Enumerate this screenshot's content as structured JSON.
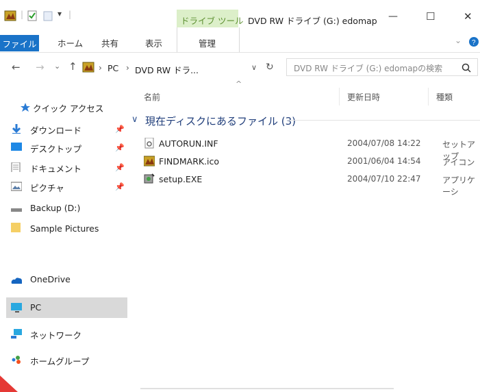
{
  "window": {
    "context_tab": "ドライブ ツール",
    "title": "DVD RW ドライブ (G:) edomap",
    "controls": {
      "minimize": "—",
      "maximize": "☐",
      "close": "✕"
    }
  },
  "ribbon": {
    "tabs": [
      "ファイル",
      "ホーム",
      "共有",
      "表示",
      "管理"
    ]
  },
  "address": {
    "crumbs": [
      "PC",
      "DVD RW ドラ..."
    ],
    "separator": "›",
    "refresh": "↻",
    "search_placeholder": "DVD RW ドライブ (G:) edomapの検索"
  },
  "sidebar": {
    "quick_access": "クイック アクセス",
    "pinned": [
      "ダウンロード",
      "デスクトップ",
      "ドキュメント",
      "ピクチャ"
    ],
    "folders": [
      "Backup (D:)",
      "Sample Pictures"
    ],
    "onedrive": "OneDrive",
    "pc": "PC",
    "network": "ネットワーク",
    "homegroup": "ホームグループ"
  },
  "content": {
    "columns": {
      "name": "名前",
      "date": "更新日時",
      "type": "種類"
    },
    "group_label": "現在ディスクにあるファイル (3)",
    "files": [
      {
        "name": "AUTORUN.INF",
        "date": "2004/07/08 14:22",
        "type": "セットアップ"
      },
      {
        "name": "FINDMARK.ico",
        "date": "2001/06/04 14:54",
        "type": "アイコン"
      },
      {
        "name": "setup.EXE",
        "date": "2004/07/10 22:47",
        "type": "アプリケーシ"
      }
    ]
  },
  "colors": {
    "file_tab": "#1a73c8",
    "context_tab": "#dcefc9",
    "selection": "#d9d9d9",
    "accent_red": "#e53935"
  }
}
